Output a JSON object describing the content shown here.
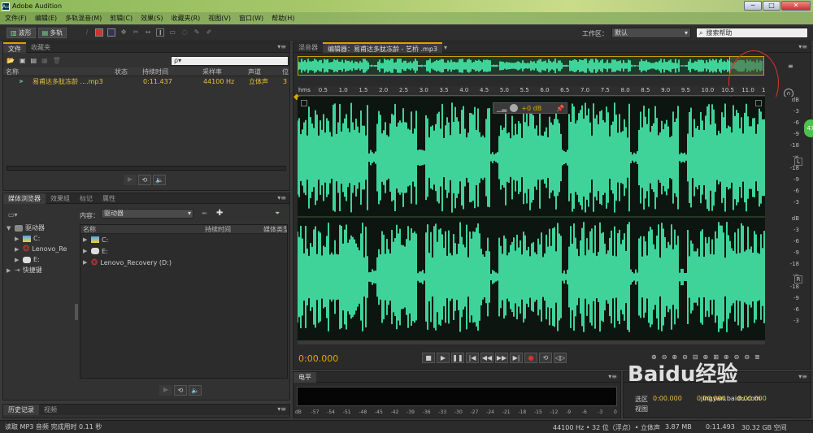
{
  "app": {
    "title": "Adobe Audition",
    "logo": "Au"
  },
  "menu": [
    "文件(F)",
    "编辑(E)",
    "多轨混音(M)",
    "剪辑(C)",
    "效果(S)",
    "收藏夹(R)",
    "视图(V)",
    "窗口(W)",
    "帮助(H)"
  ],
  "toolbar": {
    "waveform_label": "波形",
    "multitrack_label": "多轨",
    "workspace_label": "工作区：",
    "workspace_value": "默认",
    "search_placeholder": "搜索帮助"
  },
  "files_panel": {
    "tabs": [
      "文件",
      "收藏夹"
    ],
    "search_placeholder": "ρ▾",
    "columns": [
      "名称",
      "状态",
      "持续时间",
      "采样率",
      "声道",
      "位"
    ],
    "rows": [
      {
        "name": "易甫达多肽冻龄 ....mp3",
        "duration": "0:11.437",
        "rate": "44100 Hz",
        "channels": "立体声",
        "bits": "3"
      }
    ]
  },
  "media_panel": {
    "tabs": [
      "媒体浏览器",
      "效果组",
      "标记",
      "属性"
    ],
    "content_label": "内容：",
    "content_value": "驱动器",
    "tree": [
      {
        "label": "驱动器",
        "level": 0
      },
      {
        "label": "C:",
        "level": 1
      },
      {
        "label": "Lenovo_Re",
        "level": 1
      },
      {
        "label": "E:",
        "level": 1
      },
      {
        "label": "快捷键",
        "level": 0
      }
    ],
    "list_columns": [
      "名称",
      "持续时间",
      "媒体类型"
    ],
    "list": [
      "C:",
      "E:",
      "Lenovo_Recovery (D:)"
    ]
  },
  "history_panel": {
    "tabs": [
      "历史记录",
      "视频"
    ]
  },
  "status_bar": {
    "message": "读取 MP3 音频 完成用时 0.11 秒",
    "rate": "44100 Hz • 32 位（浮点）• 立体声",
    "size": "3.87 MB",
    "duration": "0:11.493",
    "free": "30.32 GB 空间"
  },
  "editor": {
    "tabs": [
      "混音器",
      "编辑器：易甫达多肽冻龄 - 艺桥 .mp3"
    ],
    "hud_label": "+0 dB",
    "time": "0:00.000",
    "ruler": [
      "hms",
      "0.5",
      "1.0",
      "1.5",
      "2.0",
      "2.5",
      "3.0",
      "3.5",
      "4.0",
      "4.5",
      "5.0",
      "5.5",
      "6.0",
      "6.5",
      "7.0",
      "7.5",
      "8.0",
      "8.5",
      "9.0",
      "9.5",
      "10.0",
      "10.5",
      "11.0",
      "1"
    ],
    "db_scale_top": [
      "dB",
      "-3",
      "-6",
      "-9",
      "-18",
      "-∞",
      "-18",
      "-9",
      "-6",
      "-3"
    ],
    "db_scale_bottom": [
      "dB",
      "-3",
      "-6",
      "-9",
      "-18",
      "-∞",
      "-18",
      "-9",
      "-6",
      "-3"
    ],
    "ch_left": "L",
    "ch_right": "R",
    "green_badge": "47"
  },
  "level_panel": {
    "tab": "电平",
    "scale": [
      "dB",
      "-57",
      "-54",
      "-51",
      "-48",
      "-45",
      "-42",
      "-39",
      "-36",
      "-33",
      "-30",
      "-27",
      "-24",
      "-21",
      "-18",
      "-15",
      "-12",
      "-9",
      "-6",
      "-3",
      "0"
    ]
  },
  "selection_panel": {
    "select_label": "选区",
    "view_label": "视图",
    "value1": "0:00.000",
    "value2": "0:00.000",
    "value3": "0:00.000"
  },
  "watermark": {
    "text": "Baidu经验",
    "sub": "jingyan.baidu.com"
  },
  "colors": {
    "waveform": "#3fd39a",
    "timecode": "#e0a800",
    "accent_red": "#e03030"
  }
}
